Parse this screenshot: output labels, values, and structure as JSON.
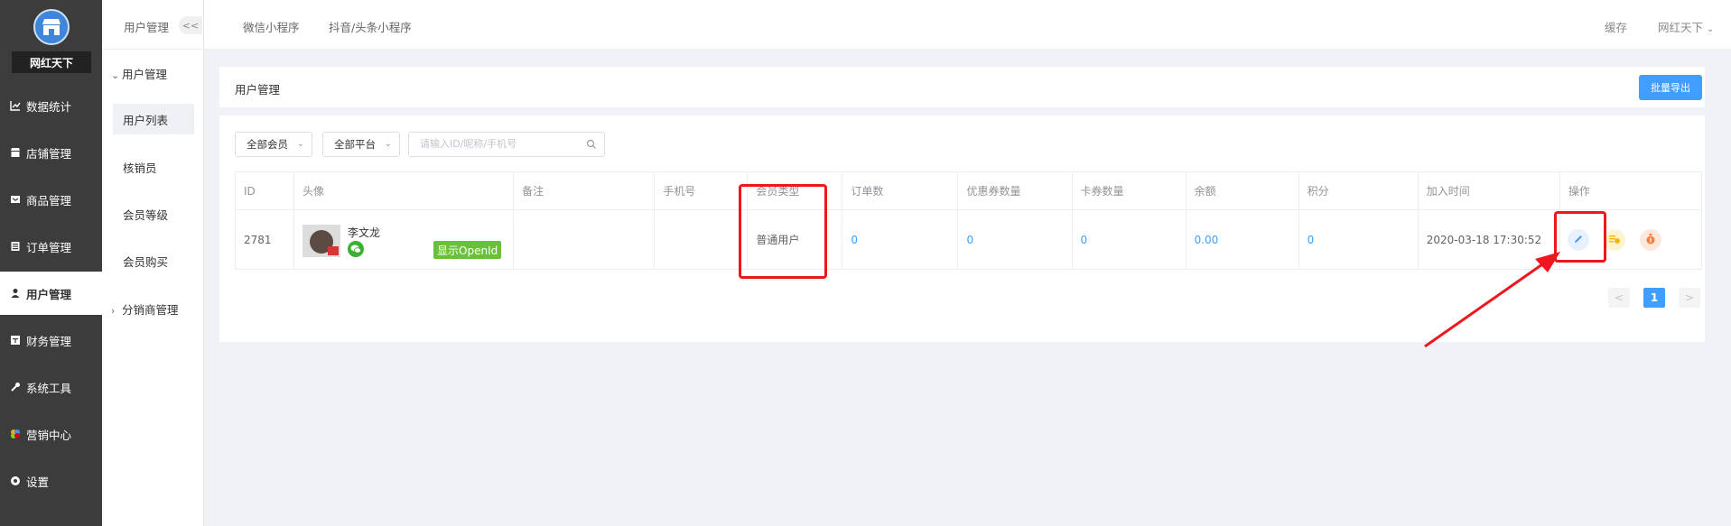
{
  "brand": {
    "name": "网红天下"
  },
  "sidebar": {
    "items": [
      {
        "label": "数据统计",
        "icon": "chart-icon"
      },
      {
        "label": "店铺管理",
        "icon": "store-icon"
      },
      {
        "label": "商品管理",
        "icon": "product-icon"
      },
      {
        "label": "订单管理",
        "icon": "order-icon"
      },
      {
        "label": "用户管理",
        "icon": "user-icon",
        "active": true
      },
      {
        "label": "财务管理",
        "icon": "finance-icon"
      },
      {
        "label": "系统工具",
        "icon": "wrench-icon"
      },
      {
        "label": "营销中心",
        "icon": "marketing-icon"
      },
      {
        "label": "设置",
        "icon": "gear-icon"
      }
    ]
  },
  "subnav": {
    "title": "用户管理",
    "collapse_label": "<<",
    "group1": {
      "label": "用户管理"
    },
    "items": [
      {
        "label": "用户列表",
        "active": true
      },
      {
        "label": "核销员"
      },
      {
        "label": "会员等级"
      },
      {
        "label": "会员购买"
      }
    ],
    "group2": {
      "label": "分销商管理"
    }
  },
  "topbar": {
    "tabs": [
      "微信小程序",
      "抖音/头条小程序"
    ],
    "cache_label": "缓存",
    "user_label": "网红天下"
  },
  "header": {
    "title": "用户管理",
    "export_label": "批量导出"
  },
  "filters": {
    "member_select": "全部会员",
    "platform_select": "全部平台",
    "search_placeholder": "请输入ID/昵称/手机号"
  },
  "table": {
    "columns": [
      "ID",
      "头像",
      "备注",
      "手机号",
      "会员类型",
      "订单数",
      "优惠券数量",
      "卡券数量",
      "余额",
      "积分",
      "加入时间",
      "操作"
    ],
    "rows": [
      {
        "id": "2781",
        "nickname": "李文龙",
        "openid_label": "显示OpenId",
        "remark": "",
        "phone": "",
        "member_type": "普通用户",
        "orders": "0",
        "coupons": "0",
        "cards": "0",
        "balance": "0.00",
        "points": "0",
        "join_time": "2020-03-18 17:30:52"
      }
    ]
  },
  "pagination": {
    "prev": "<",
    "current": "1",
    "next": ">"
  },
  "colors": {
    "primary": "#409eff",
    "sidebar": "#3c3c3c",
    "openid_green": "#67c23a",
    "highlight_red": "#f0161e"
  }
}
